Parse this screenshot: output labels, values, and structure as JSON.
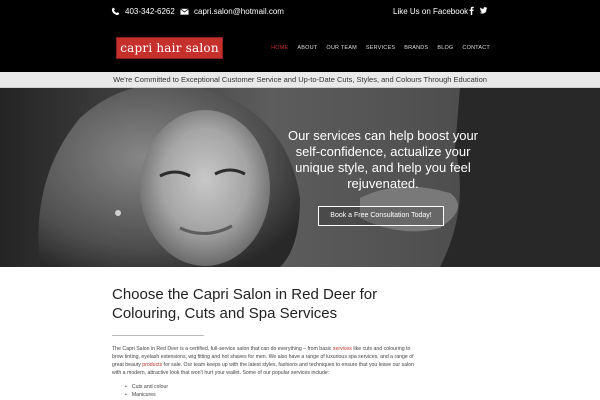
{
  "topbar": {
    "phone": "403-342-6262",
    "email": "capri.salon@hotmail.com",
    "facebook_text": "Like Us on Facebook",
    "icons": {
      "phone": "phone-icon",
      "email": "envelope-icon",
      "facebook": "facebook-icon",
      "twitter": "twitter-icon"
    }
  },
  "header": {
    "logo_text": "capri hair salon",
    "nav": [
      "HOME",
      "ABOUT",
      "OUR TEAM",
      "SERVICES",
      "BRANDS",
      "BLOG",
      "CONTACT"
    ],
    "active_nav": "HOME"
  },
  "tagline": "We're Committed to Exceptional Customer Service and Up-to-Date Cuts, Styles, and Colours Through Education",
  "hero": {
    "text": "Our services can help boost your self-confidence, actualize your unique style, and help you feel rejuvenated.",
    "button": "Book a Free Consultation Today!"
  },
  "main": {
    "heading_line1": "Choose the Capri Salon in Red Deer for",
    "heading_line2": "Colouring, Cuts and Spa Services",
    "para_part1": "The Capri Salon in Red Deer is a certified, full-service salon that can do everything – from basic ",
    "para_link1": "services",
    "para_part2": " like cuts and colouring to brow tinting, eyelash extensions, wig fitting and hot shaves for men. We also have a range of luxurious spa services, and a range of great beauty ",
    "para_link2": "products",
    "para_part3": " for sale. Our team keeps up with the latest styles, fashions and techniques to ensure that you leave our salon with a modern, attractive look that won't hurt your wallet. Some of our popular services include:",
    "services": [
      "Cuts and colour",
      "Manicures"
    ]
  },
  "colors": {
    "brand": "#c6302c",
    "topbar": "#000000",
    "tagline_bg": "#e9e9e9"
  }
}
